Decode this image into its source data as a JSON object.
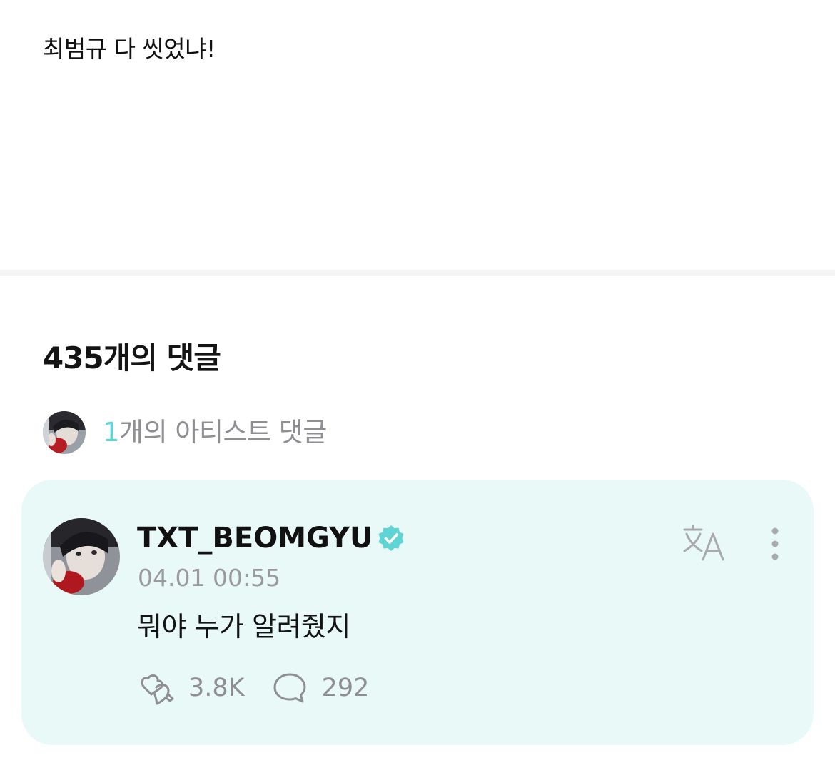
{
  "post": {
    "body_text": "최범규 다 씻었냐!"
  },
  "comments": {
    "title": "435개의 댓글",
    "artist_summary": {
      "count": "1",
      "label": "개의 아티스트 댓글",
      "accent_color": "#5fd4d4"
    }
  },
  "artist_comment": {
    "author": "TXT_BEOMGYU",
    "verified": true,
    "verified_icon": "verified-badge-icon",
    "timestamp": "04.01 00:55",
    "text": "뭐야 누가 알려줬지",
    "likes": "3.8K",
    "replies": "292",
    "like_icon": "cheer-heart-icon",
    "reply_icon": "speech-bubble-icon",
    "translate_icon": "translate-icon",
    "more_icon": "more-vertical-icon",
    "card_color": "#e9f9f7"
  }
}
